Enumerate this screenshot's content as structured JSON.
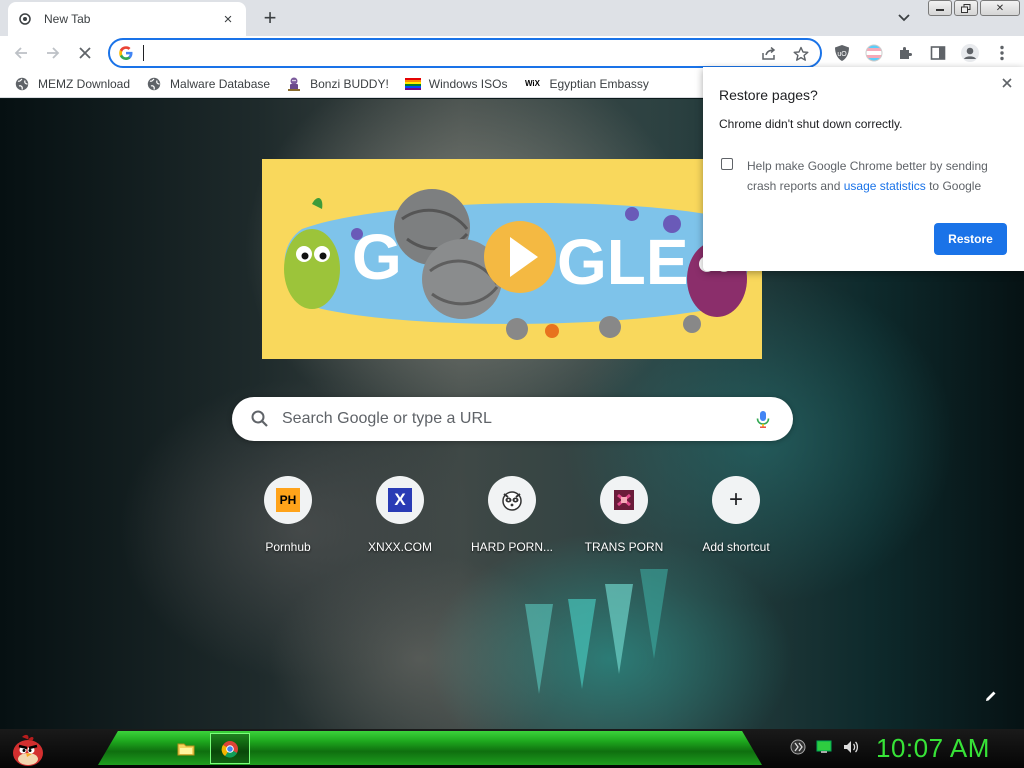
{
  "tab": {
    "title": "New Tab",
    "close_label": "×"
  },
  "window": {
    "new_tab_label": "+",
    "close_label": "✕"
  },
  "toolbar": {
    "omnibox_value": ""
  },
  "bookmarks": [
    {
      "label": "MEMZ Download",
      "icon": "globe-icon"
    },
    {
      "label": "Malware Database",
      "icon": "globe-icon"
    },
    {
      "label": "Bonzi BUDDY!",
      "icon": "bonzi-icon"
    },
    {
      "label": "Windows ISOs",
      "icon": "rainbow-flag-icon"
    },
    {
      "label": "Egyptian Embassy",
      "icon": "wix-icon"
    }
  ],
  "bookmark_icons": {
    "wix": "WiX"
  },
  "newtab": {
    "search_placeholder": "Search Google or type a URL",
    "shortcuts": [
      {
        "label": "Pornhub",
        "icon_text": "PH"
      },
      {
        "label": "XNXX.COM",
        "icon_text": "X"
      },
      {
        "label": "HARD PORN...",
        "icon_text": ""
      },
      {
        "label": "TRANS PORN",
        "icon_text": ""
      },
      {
        "label": "Add shortcut",
        "icon_text": "+"
      }
    ]
  },
  "restore_popup": {
    "title": "Restore pages?",
    "message": "Chrome didn't shut down correctly.",
    "checkbox_text": "Help make Google Chrome better by sending crash reports and ",
    "checkbox_link": "usage statistics",
    "checkbox_suffix": " to Google",
    "checkbox_checked": false,
    "restore_label": "Restore"
  },
  "taskbar": {
    "clock": "10:07 AM"
  },
  "colors": {
    "accent": "#1a73e8",
    "taskbar_green": "#37e337",
    "doodle_bg": "#f9d85c"
  }
}
